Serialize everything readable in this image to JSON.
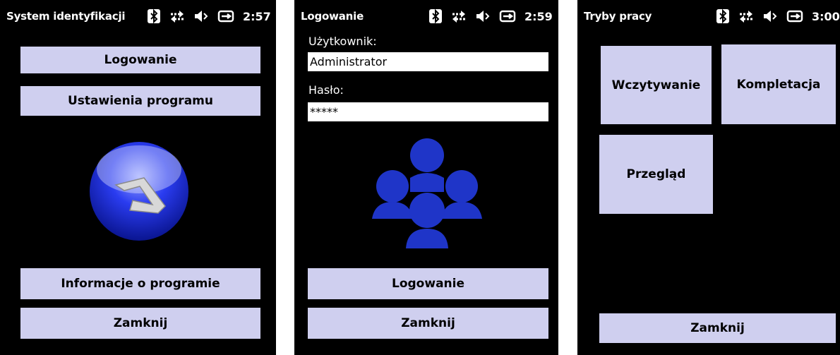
{
  "status_icons": [
    "bluetooth-icon",
    "sync-arrows-icon",
    "speaker-muted-icon",
    "battery-charging-icon"
  ],
  "colors": {
    "button_bg": "#cfcfef",
    "screen_bg": "#000000",
    "logo_blue": "#1426c8",
    "users_blue": "#1f35c8"
  },
  "screen1": {
    "title": "System identyfikacji",
    "time": "2:57",
    "buttons": {
      "login": "Logowanie",
      "settings": "Ustawienia programu",
      "info": "Informacje o programie",
      "close": "Zamknij"
    },
    "logo_icon": "app-logo-icon"
  },
  "screen2": {
    "title": "Logowanie",
    "time": "2:59",
    "user_label": "Użytkownik:",
    "user_value": "Administrator",
    "password_label": "Hasło:",
    "password_value": "*****",
    "users_icon": "users-group-icon",
    "buttons": {
      "login": "Logowanie",
      "close": "Zamknij"
    }
  },
  "screen3": {
    "title": "Tryby pracy",
    "time": "3:00",
    "tiles": {
      "load": "Wczytywanie",
      "complete": "Kompletacja",
      "review": "Przegląd"
    },
    "buttons": {
      "close": "Zamknij"
    }
  }
}
